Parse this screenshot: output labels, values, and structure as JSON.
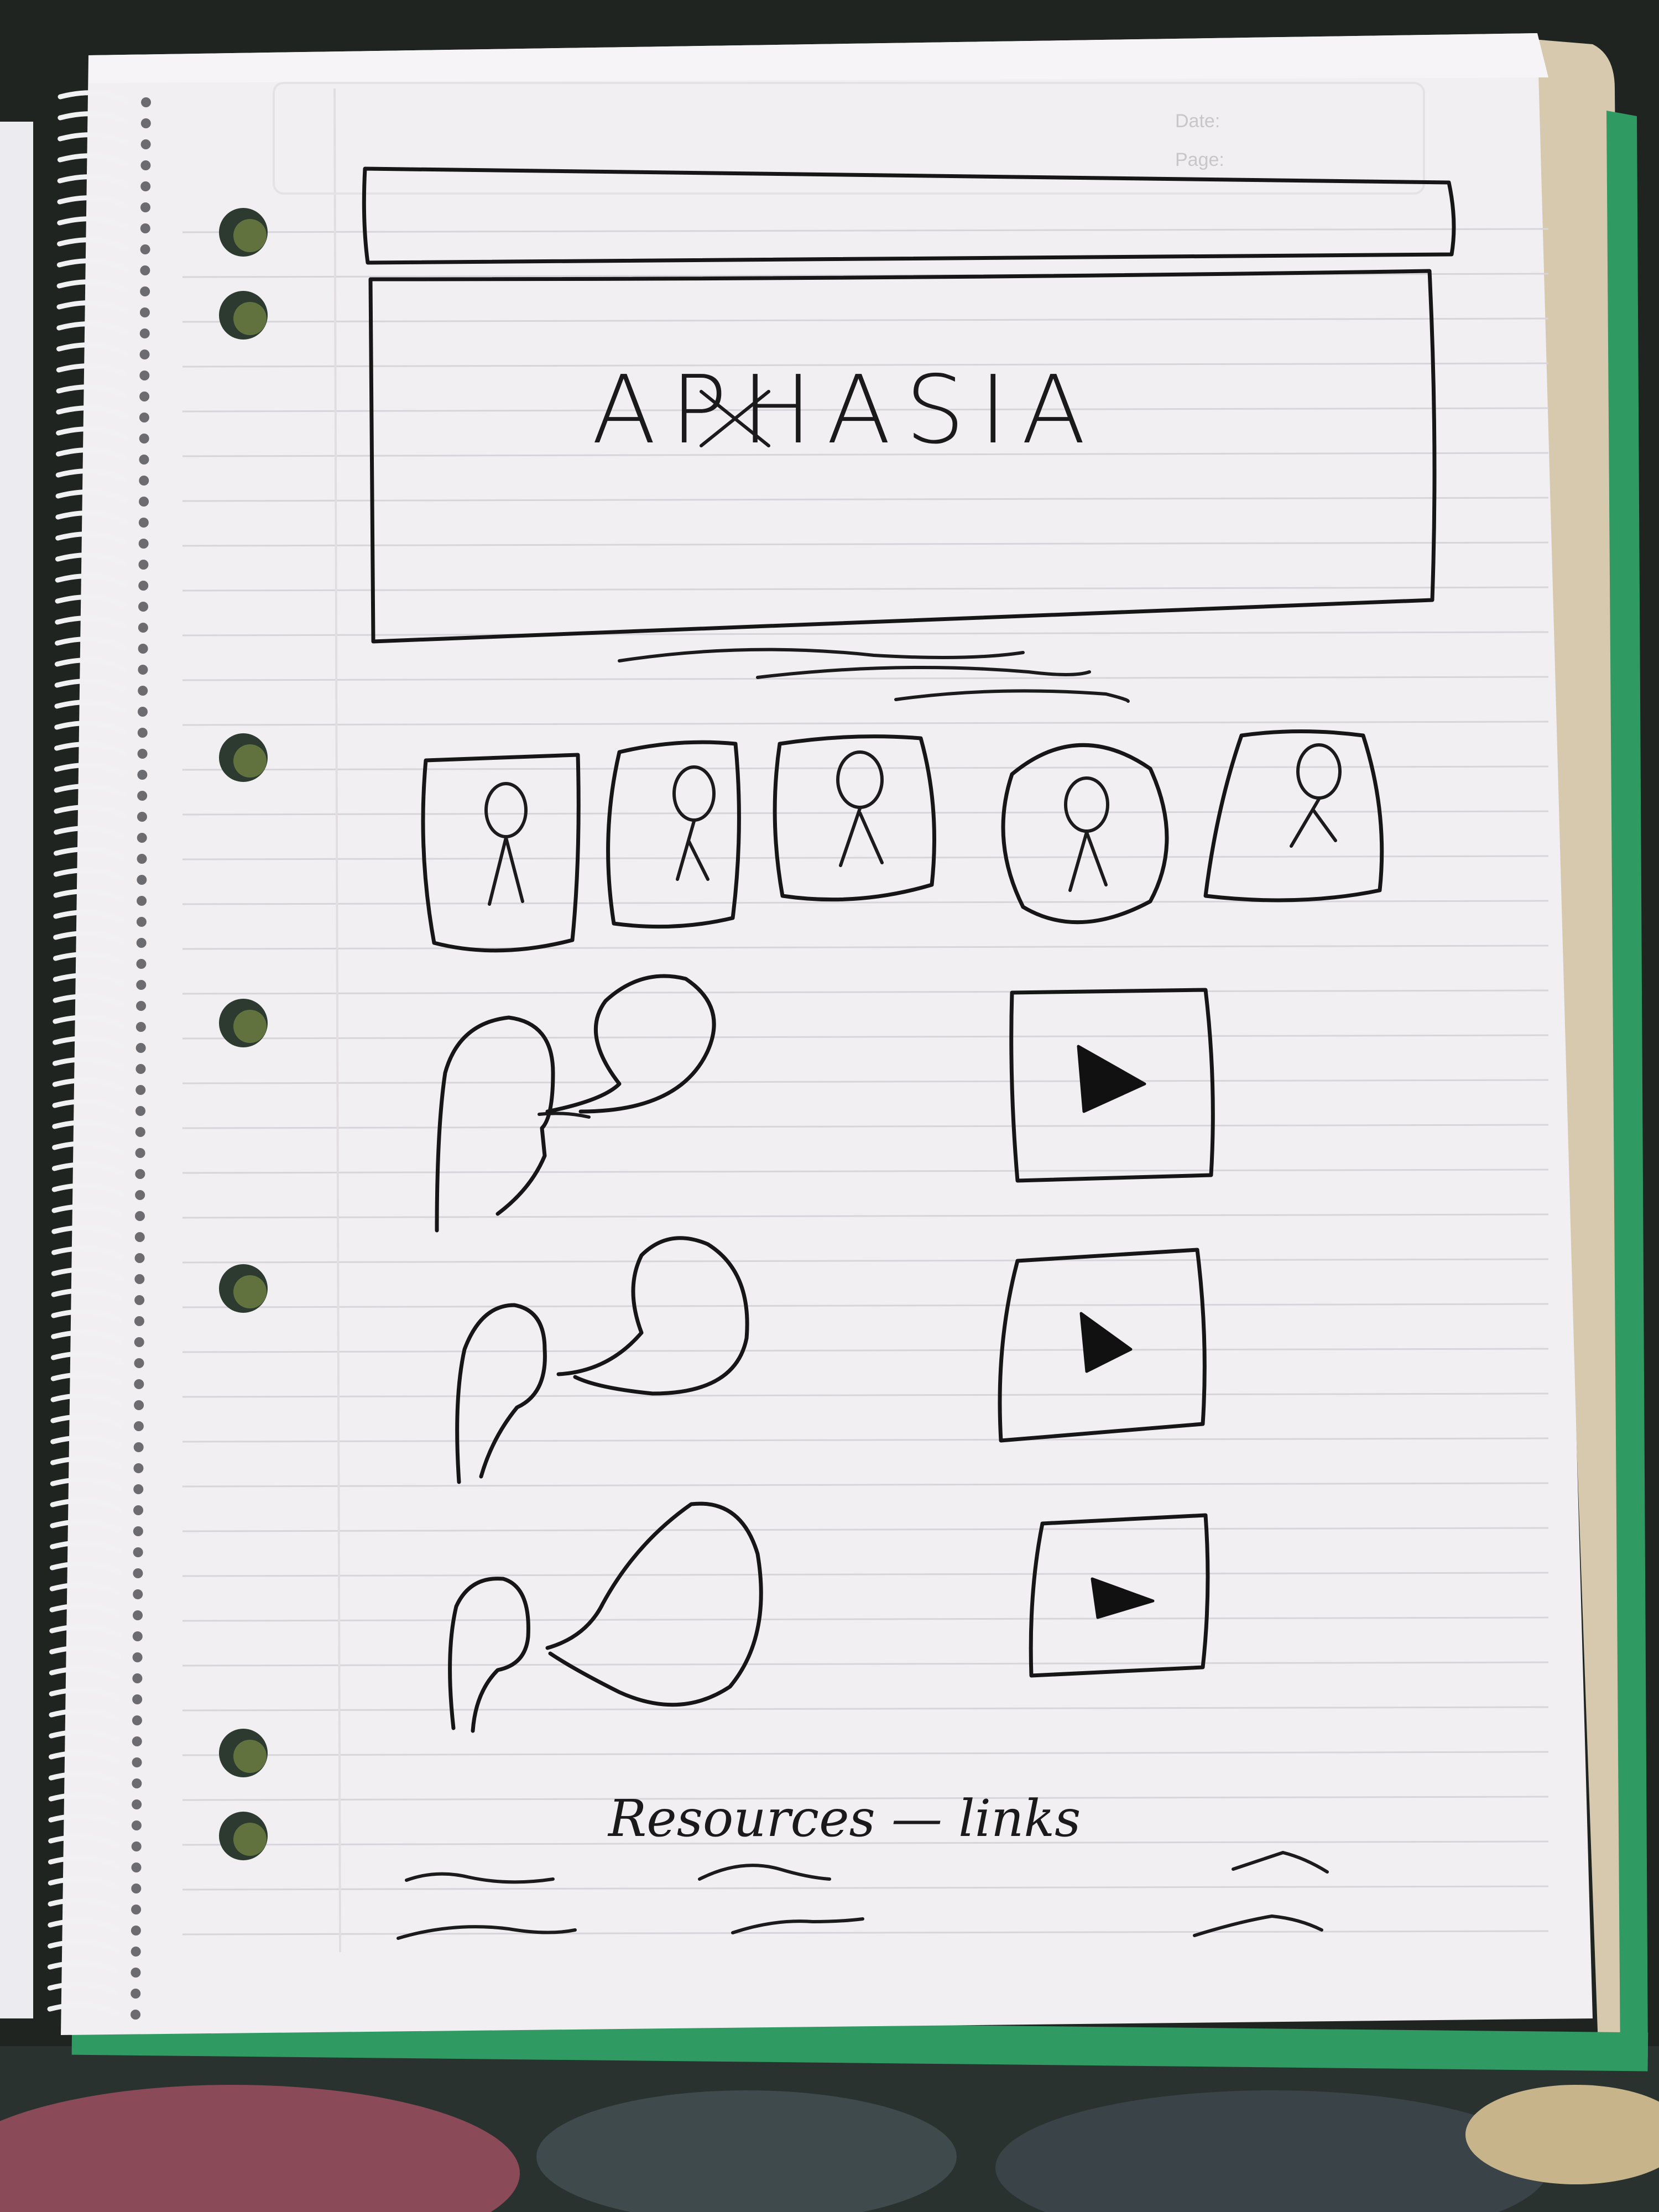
{
  "sketch": {
    "header_mark": {
      "date_label": "Date:",
      "page_label": "Page:"
    },
    "banner": {
      "title": "APHASIA"
    },
    "avatars": {
      "count": 5
    },
    "conversations": {
      "count": 3
    },
    "footer": {
      "heading": "Resources — links"
    },
    "colors": {
      "paper": "#f2eff3",
      "ink": "#161616",
      "rule_line": "#d7d4db",
      "margin_line": "#e2dde0",
      "background": "#1f2421",
      "folder": "#d7c9ad",
      "green_cover": "#2f9a62"
    }
  }
}
